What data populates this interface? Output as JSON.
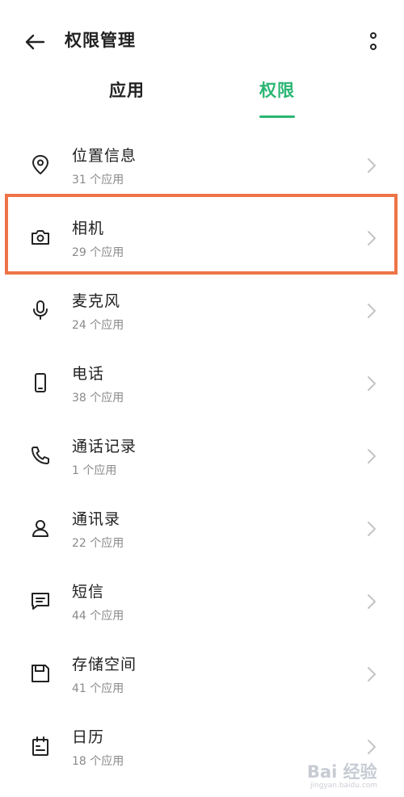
{
  "header": {
    "title": "权限管理"
  },
  "tabs": [
    {
      "label": "应用",
      "active": false
    },
    {
      "label": "权限",
      "active": true
    }
  ],
  "accent_color": "#2bb673",
  "highlight_color": "#ee7447",
  "permissions": [
    {
      "icon": "location-pin-icon",
      "title": "位置信息",
      "subtitle": "31 个应用"
    },
    {
      "icon": "camera-icon",
      "title": "相机",
      "subtitle": "29 个应用"
    },
    {
      "icon": "microphone-icon",
      "title": "麦克风",
      "subtitle": "24 个应用"
    },
    {
      "icon": "phone-device-icon",
      "title": "电话",
      "subtitle": "38 个应用"
    },
    {
      "icon": "phone-handset-icon",
      "title": "通话记录",
      "subtitle": "1 个应用"
    },
    {
      "icon": "person-icon",
      "title": "通讯录",
      "subtitle": "22 个应用"
    },
    {
      "icon": "message-icon",
      "title": "短信",
      "subtitle": "44 个应用"
    },
    {
      "icon": "storage-icon",
      "title": "存储空间",
      "subtitle": "41 个应用"
    },
    {
      "icon": "calendar-icon",
      "title": "日历",
      "subtitle": "18 个应用"
    }
  ],
  "watermark": {
    "main": "Bai 经验",
    "sub": "jingyan.baidu.com"
  }
}
